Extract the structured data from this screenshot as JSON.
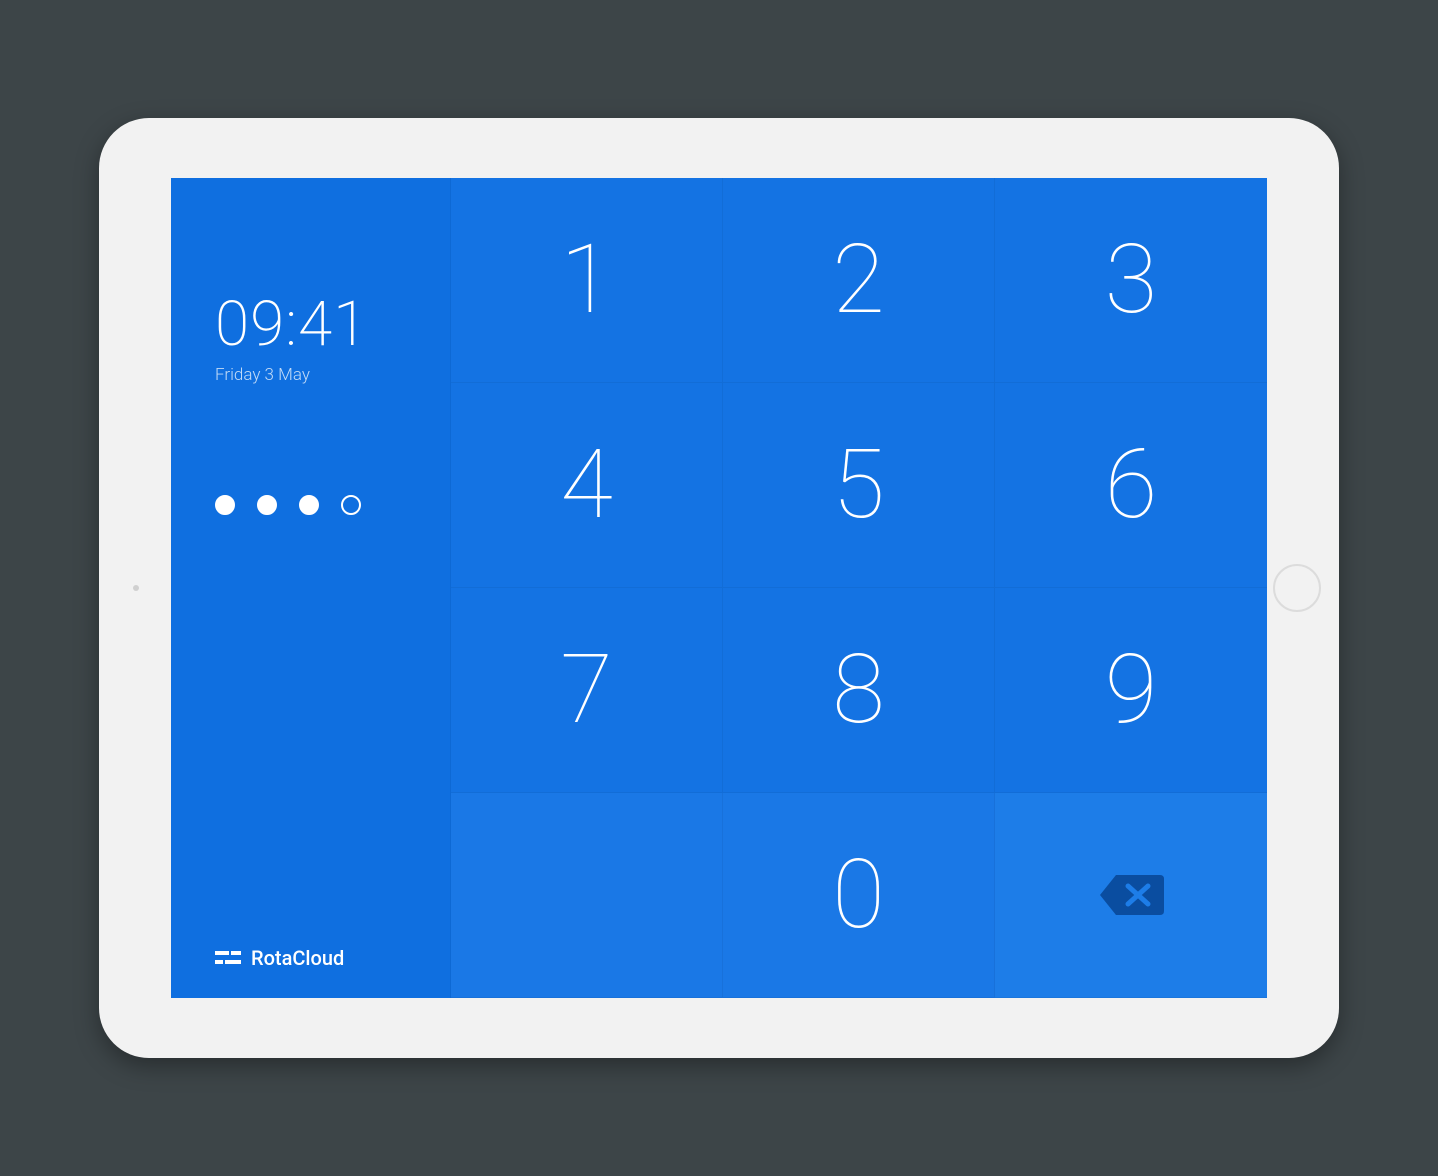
{
  "sidebar": {
    "clock": "09:41",
    "date": "Friday 3 May",
    "pin_length": 4,
    "pin_filled": 3,
    "brand": "RotaCloud"
  },
  "keypad": {
    "keys": [
      "1",
      "2",
      "3",
      "4",
      "5",
      "6",
      "7",
      "8",
      "9",
      "",
      "0",
      "backspace"
    ],
    "k1": "1",
    "k2": "2",
    "k3": "3",
    "k4": "4",
    "k5": "5",
    "k6": "6",
    "k7": "7",
    "k8": "8",
    "k9": "9",
    "k0": "0"
  },
  "colors": {
    "brand_blue": "#0f6fe0",
    "key_blue": "#1473e3",
    "accent_dark": "#0a4da0"
  }
}
